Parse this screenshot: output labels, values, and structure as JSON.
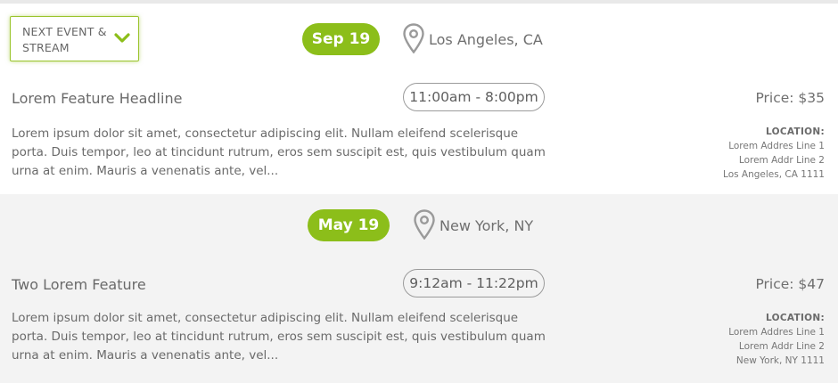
{
  "filter": {
    "label": "NEXT EVENT & STREAM",
    "chevron_icon": "chevron-down-icon",
    "accent_color": "#8cbe1a"
  },
  "events": [
    {
      "date": "Sep 19",
      "city": "Los Angeles, CA",
      "headline": "Lorem Feature Headline",
      "time": "11:00am - 8:00pm",
      "price": "Price: $35",
      "description": "Lorem ipsum dolor sit amet, consectetur adipiscing elit. Nullam eleifend scelerisque porta. Duis tempor, leo at tincidunt rutrum, eros sem suscipit est, quis vestibulum quam urna at enim. Mauris a venenatis ante, vel...",
      "location": {
        "heading": "LOCATION:",
        "line1": "Lorem Addres Line 1",
        "line2": "Lorem Addr Line 2",
        "line3": "Los Angeles, CA 1111"
      }
    },
    {
      "date": "May 19",
      "city": "New York, NY",
      "headline": "Two Lorem Feature",
      "time": "9:12am - 11:22pm",
      "price": "Price: $47",
      "description": "Lorem ipsum dolor sit amet, consectetur adipiscing elit. Nullam eleifend scelerisque porta. Duis tempor, leo at tincidunt rutrum, eros sem suscipit est, quis vestibulum quam urna at enim. Mauris a venenatis ante, vel...",
      "location": {
        "heading": "LOCATION:",
        "line1": "Lorem Addres Line 1",
        "line2": "Lorem Addr Line 2",
        "line3": "New York, NY 1111"
      }
    }
  ]
}
